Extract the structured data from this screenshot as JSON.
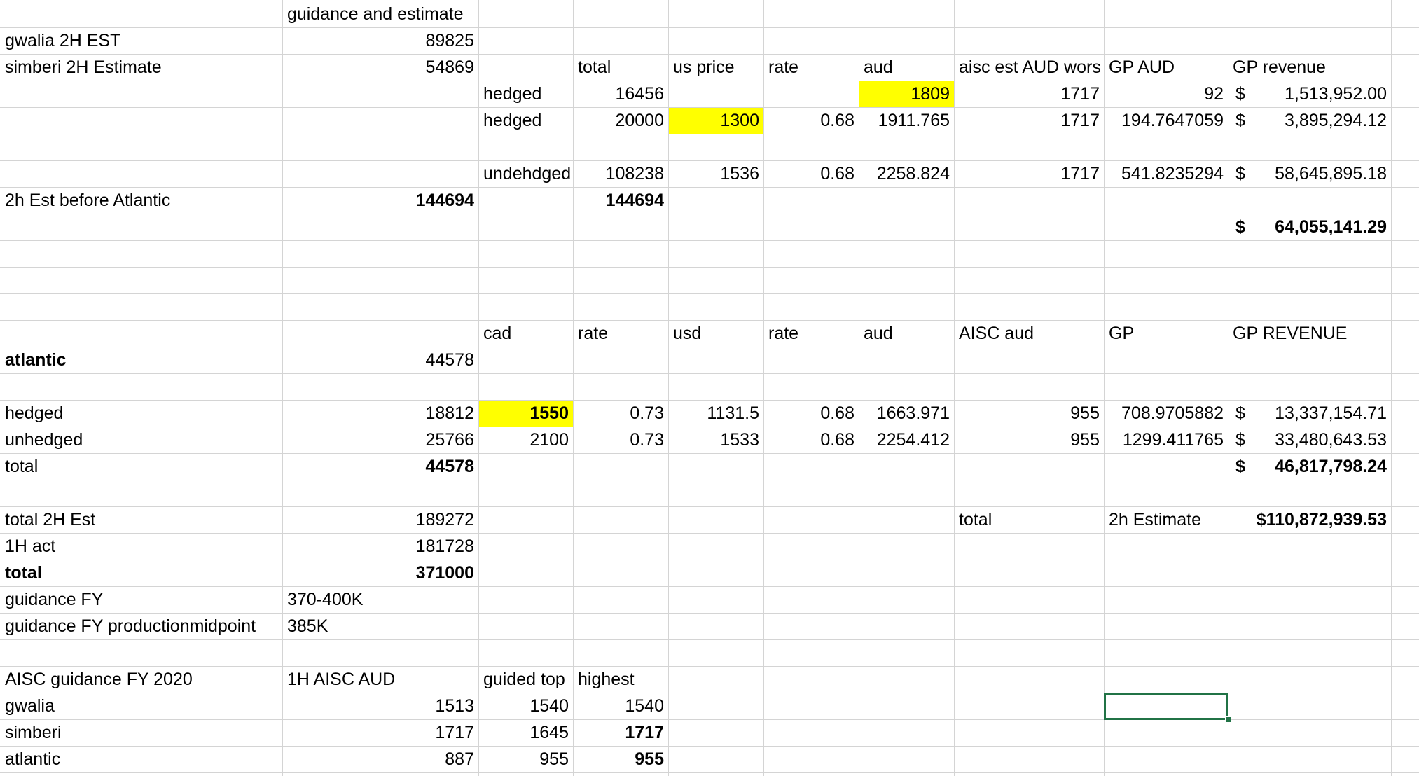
{
  "sheet": {
    "selected_cell": {
      "row": 26,
      "col": 8
    },
    "cells": [
      {
        "row": 0,
        "col": 1,
        "text": "guidance and estimate",
        "align": "l"
      },
      {
        "row": 1,
        "col": 0,
        "text": "gwalia 2H EST",
        "align": "l"
      },
      {
        "row": 1,
        "col": 1,
        "text": "89825",
        "align": "r"
      },
      {
        "row": 2,
        "col": 0,
        "text": "simberi 2H Estimate",
        "align": "l"
      },
      {
        "row": 2,
        "col": 1,
        "text": "54869",
        "align": "r"
      },
      {
        "row": 2,
        "col": 3,
        "text": "total",
        "align": "l"
      },
      {
        "row": 2,
        "col": 4,
        "text": "us price",
        "align": "l"
      },
      {
        "row": 2,
        "col": 5,
        "text": "rate",
        "align": "l"
      },
      {
        "row": 2,
        "col": 6,
        "text": "aud",
        "align": "l"
      },
      {
        "row": 2,
        "col": 7,
        "text": "aisc est AUD wors",
        "align": "l"
      },
      {
        "row": 2,
        "col": 8,
        "text": "GP AUD",
        "align": "l"
      },
      {
        "row": 2,
        "col": 9,
        "text": "GP revenue",
        "align": "l"
      },
      {
        "row": 3,
        "col": 2,
        "text": "hedged",
        "align": "l"
      },
      {
        "row": 3,
        "col": 3,
        "text": "16456",
        "align": "r"
      },
      {
        "row": 3,
        "col": 6,
        "text": "1809",
        "align": "r",
        "highlight": true
      },
      {
        "row": 3,
        "col": 7,
        "text": "1717",
        "align": "r"
      },
      {
        "row": 3,
        "col": 8,
        "text": "92",
        "align": "r"
      },
      {
        "row": 3,
        "col": 9,
        "text": "1,513,952.00",
        "align": "cur"
      },
      {
        "row": 4,
        "col": 2,
        "text": "hedged",
        "align": "l"
      },
      {
        "row": 4,
        "col": 3,
        "text": "20000",
        "align": "r"
      },
      {
        "row": 4,
        "col": 4,
        "text": "1300",
        "align": "r",
        "highlight": true
      },
      {
        "row": 4,
        "col": 5,
        "text": "0.68",
        "align": "r"
      },
      {
        "row": 4,
        "col": 6,
        "text": "1911.765",
        "align": "r"
      },
      {
        "row": 4,
        "col": 7,
        "text": "1717",
        "align": "r"
      },
      {
        "row": 4,
        "col": 8,
        "text": "194.7647059",
        "align": "r"
      },
      {
        "row": 4,
        "col": 9,
        "text": "3,895,294.12",
        "align": "cur"
      },
      {
        "row": 6,
        "col": 2,
        "text": "undehdged",
        "align": "l"
      },
      {
        "row": 6,
        "col": 3,
        "text": "108238",
        "align": "r"
      },
      {
        "row": 6,
        "col": 4,
        "text": "1536",
        "align": "r"
      },
      {
        "row": 6,
        "col": 5,
        "text": "0.68",
        "align": "r"
      },
      {
        "row": 6,
        "col": 6,
        "text": "2258.824",
        "align": "r"
      },
      {
        "row": 6,
        "col": 7,
        "text": "1717",
        "align": "r"
      },
      {
        "row": 6,
        "col": 8,
        "text": "541.8235294",
        "align": "r"
      },
      {
        "row": 6,
        "col": 9,
        "text": "58,645,895.18",
        "align": "cur"
      },
      {
        "row": 7,
        "col": 0,
        "text": "2h Est before Atlantic",
        "align": "l"
      },
      {
        "row": 7,
        "col": 1,
        "text": "144694",
        "align": "r",
        "bold": true
      },
      {
        "row": 7,
        "col": 3,
        "text": "144694",
        "align": "r",
        "bold": true
      },
      {
        "row": 8,
        "col": 9,
        "text": "64,055,141.29",
        "align": "cur",
        "bold": true
      },
      {
        "row": 12,
        "col": 2,
        "text": "cad",
        "align": "l"
      },
      {
        "row": 12,
        "col": 3,
        "text": "rate",
        "align": "l"
      },
      {
        "row": 12,
        "col": 4,
        "text": "usd",
        "align": "l"
      },
      {
        "row": 12,
        "col": 5,
        "text": "rate",
        "align": "l"
      },
      {
        "row": 12,
        "col": 6,
        "text": "aud",
        "align": "l"
      },
      {
        "row": 12,
        "col": 7,
        "text": "AISC aud",
        "align": "l"
      },
      {
        "row": 12,
        "col": 8,
        "text": "GP",
        "align": "l"
      },
      {
        "row": 12,
        "col": 9,
        "text": "GP REVENUE",
        "align": "l"
      },
      {
        "row": 13,
        "col": 0,
        "text": "atlantic",
        "align": "l",
        "bold": true
      },
      {
        "row": 13,
        "col": 1,
        "text": "44578",
        "align": "r"
      },
      {
        "row": 15,
        "col": 0,
        "text": "hedged",
        "align": "l"
      },
      {
        "row": 15,
        "col": 1,
        "text": "18812",
        "align": "r"
      },
      {
        "row": 15,
        "col": 2,
        "text": "1550",
        "align": "r",
        "bold": true,
        "highlight": true
      },
      {
        "row": 15,
        "col": 3,
        "text": "0.73",
        "align": "r"
      },
      {
        "row": 15,
        "col": 4,
        "text": "1131.5",
        "align": "r"
      },
      {
        "row": 15,
        "col": 5,
        "text": "0.68",
        "align": "r"
      },
      {
        "row": 15,
        "col": 6,
        "text": "1663.971",
        "align": "r"
      },
      {
        "row": 15,
        "col": 7,
        "text": "955",
        "align": "r"
      },
      {
        "row": 15,
        "col": 8,
        "text": "708.9705882",
        "align": "r"
      },
      {
        "row": 15,
        "col": 9,
        "text": "13,337,154.71",
        "align": "cur"
      },
      {
        "row": 16,
        "col": 0,
        "text": "unhedged",
        "align": "l"
      },
      {
        "row": 16,
        "col": 1,
        "text": "25766",
        "align": "r"
      },
      {
        "row": 16,
        "col": 2,
        "text": "2100",
        "align": "r"
      },
      {
        "row": 16,
        "col": 3,
        "text": "0.73",
        "align": "r"
      },
      {
        "row": 16,
        "col": 4,
        "text": "1533",
        "align": "r"
      },
      {
        "row": 16,
        "col": 5,
        "text": "0.68",
        "align": "r"
      },
      {
        "row": 16,
        "col": 6,
        "text": "2254.412",
        "align": "r"
      },
      {
        "row": 16,
        "col": 7,
        "text": "955",
        "align": "r"
      },
      {
        "row": 16,
        "col": 8,
        "text": "1299.411765",
        "align": "r"
      },
      {
        "row": 16,
        "col": 9,
        "text": "33,480,643.53",
        "align": "cur"
      },
      {
        "row": 17,
        "col": 0,
        "text": "total",
        "align": "l"
      },
      {
        "row": 17,
        "col": 1,
        "text": "44578",
        "align": "r",
        "bold": true
      },
      {
        "row": 17,
        "col": 9,
        "text": "46,817,798.24",
        "align": "cur",
        "bold": true
      },
      {
        "row": 19,
        "col": 0,
        "text": "total  2H Est",
        "align": "l"
      },
      {
        "row": 19,
        "col": 1,
        "text": "189272",
        "align": "r"
      },
      {
        "row": 19,
        "col": 7,
        "text": "total",
        "align": "l"
      },
      {
        "row": 19,
        "col": 8,
        "text": "2h Estimate",
        "align": "l"
      },
      {
        "row": 19,
        "col": 9,
        "text": "$110,872,939.53",
        "align": "r",
        "bold": true
      },
      {
        "row": 20,
        "col": 0,
        "text": "1H act",
        "align": "l"
      },
      {
        "row": 20,
        "col": 1,
        "text": "181728",
        "align": "r"
      },
      {
        "row": 21,
        "col": 0,
        "text": "total",
        "align": "l",
        "bold": true
      },
      {
        "row": 21,
        "col": 1,
        "text": "371000",
        "align": "r",
        "bold": true
      },
      {
        "row": 22,
        "col": 0,
        "text": "guidance FY",
        "align": "l"
      },
      {
        "row": 22,
        "col": 1,
        "text": "370-400K",
        "align": "l"
      },
      {
        "row": 23,
        "col": 0,
        "text": "guidance FY productionmidpoint",
        "align": "l"
      },
      {
        "row": 23,
        "col": 1,
        "text": "385K",
        "align": "l"
      },
      {
        "row": 25,
        "col": 0,
        "text": "AISC guidance FY 2020",
        "align": "l"
      },
      {
        "row": 25,
        "col": 1,
        "text": "1H AISC AUD",
        "align": "l"
      },
      {
        "row": 25,
        "col": 2,
        "text": "guided top",
        "align": "l"
      },
      {
        "row": 25,
        "col": 3,
        "text": "highest",
        "align": "l"
      },
      {
        "row": 26,
        "col": 0,
        "text": "gwalia",
        "align": "l"
      },
      {
        "row": 26,
        "col": 1,
        "text": "1513",
        "align": "r"
      },
      {
        "row": 26,
        "col": 2,
        "text": "1540",
        "align": "r"
      },
      {
        "row": 26,
        "col": 3,
        "text": "1540",
        "align": "r"
      },
      {
        "row": 27,
        "col": 0,
        "text": "simberi",
        "align": "l"
      },
      {
        "row": 27,
        "col": 1,
        "text": "1717",
        "align": "r"
      },
      {
        "row": 27,
        "col": 2,
        "text": "1645",
        "align": "r"
      },
      {
        "row": 27,
        "col": 3,
        "text": "1717",
        "align": "r",
        "bold": true
      },
      {
        "row": 28,
        "col": 0,
        "text": "atlantic",
        "align": "l"
      },
      {
        "row": 28,
        "col": 1,
        "text": "887",
        "align": "r"
      },
      {
        "row": 28,
        "col": 2,
        "text": "955",
        "align": "r"
      },
      {
        "row": 28,
        "col": 3,
        "text": "955",
        "align": "r",
        "bold": true
      }
    ]
  },
  "currency_symbol": "$",
  "colors": {
    "gridline": "#d4d4d4",
    "highlight": "#ffff00",
    "selection": "#217346",
    "text": "#000000"
  }
}
